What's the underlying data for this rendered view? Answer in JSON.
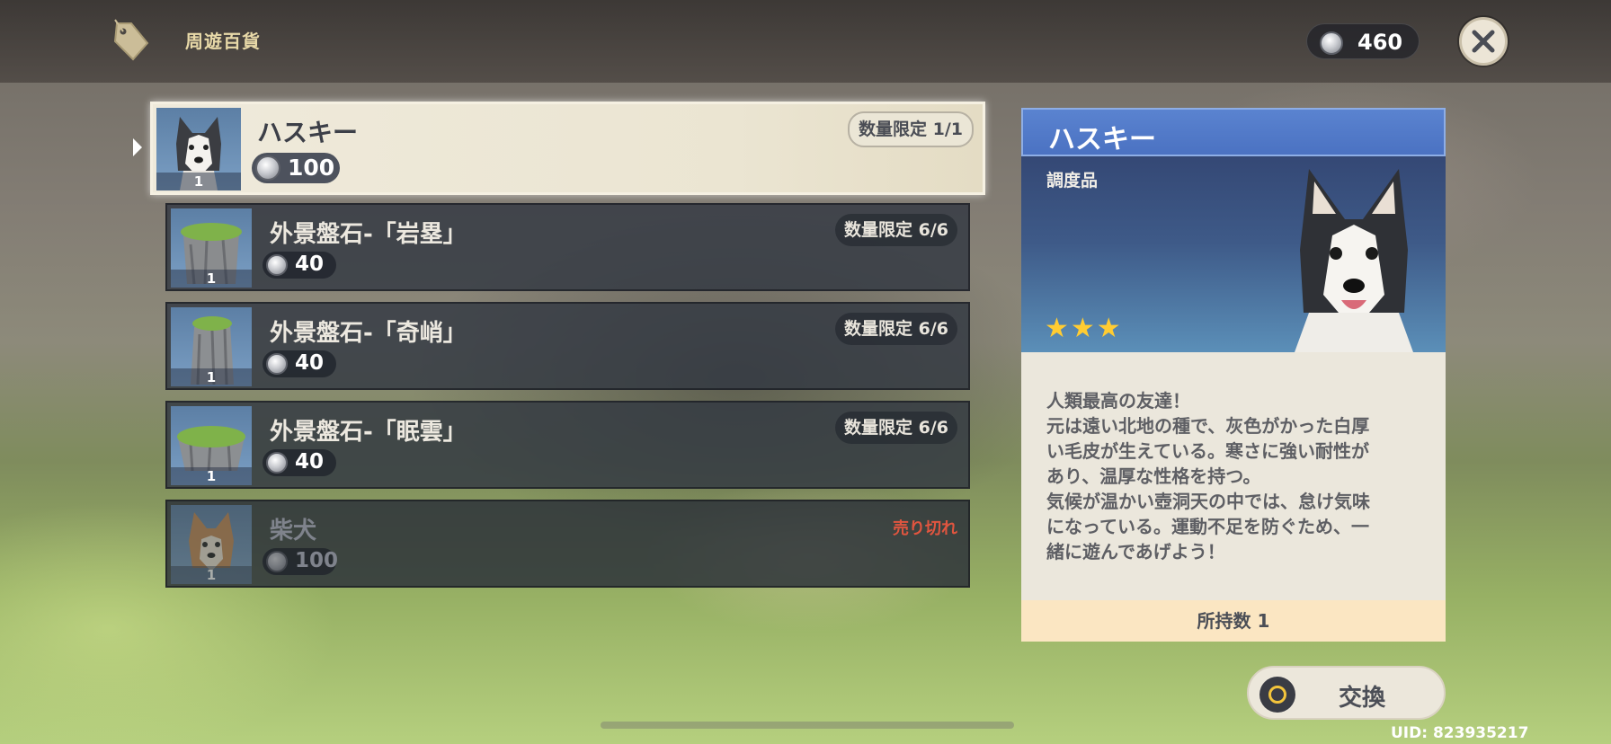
{
  "header": {
    "shop_title": "周遊百貨",
    "currency_amount": "460",
    "icons": {
      "shop": "price-tag-icon",
      "currency": "coin-icon",
      "close": "close-icon"
    }
  },
  "items": [
    {
      "name": "ハスキー",
      "price": "100",
      "owned_count": "1",
      "limit": "数量限定 1/1",
      "thumb": "husky-dog",
      "selected": true
    },
    {
      "name": "外景盤石-「岩塁」",
      "price": "40",
      "owned_count": "1",
      "limit": "数量限定 6/6",
      "thumb": "rock-tall"
    },
    {
      "name": "外景盤石-「奇峭」",
      "price": "40",
      "owned_count": "1",
      "limit": "数量限定 6/6",
      "thumb": "rock-spire"
    },
    {
      "name": "外景盤石-「眠雲」",
      "price": "40",
      "owned_count": "1",
      "limit": "数量限定 6/6",
      "thumb": "rock-flat"
    },
    {
      "name": "柴犬",
      "price": "100",
      "owned_count": "1",
      "status": "売り切れ",
      "thumb": "shiba-dog"
    }
  ],
  "detail": {
    "title": "ハスキー",
    "category": "調度品",
    "stars": "★★★",
    "rarity": 3,
    "description": "人類最高の友達！\n元は遠い北地の種で、灰色がかった白厚\nい毛皮が生えている。寒さに強い耐性が\nあり、温厚な性格を持つ。\n気候が温かい壺洞天の中では、怠け気味\nになっている。運動不足を防ぐため、一\n緒に遊んであげよう！",
    "owned": "所持数 1"
  },
  "actions": {
    "exchange_label": "交換"
  },
  "footer": {
    "uid": "UID: 823935217"
  },
  "colors": {
    "accent_blue": "#4b72c2",
    "soldout_red": "#e0553f",
    "star_gold": "#ffcc32",
    "owned_bar": "#fbe6c2"
  }
}
